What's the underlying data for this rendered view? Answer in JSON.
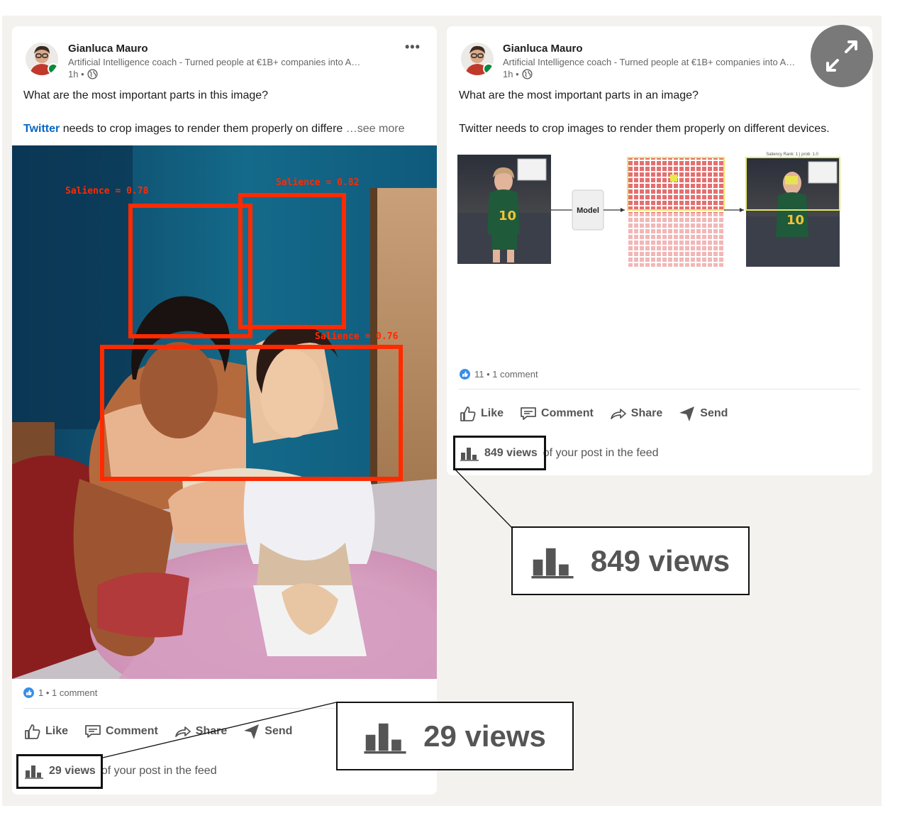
{
  "left_post": {
    "author": "Gianluca Mauro",
    "headline": "Artificial Intelligence coach - Turned people at €1B+ companies into A…",
    "time": "1h •",
    "text": "What are the most important parts in this image?",
    "line2_link": "Twitter",
    "line2_rest": " needs to crop images to render them properly on differe",
    "see_more": "…see more",
    "salience": [
      "Salience = 0.78",
      "Salience = 0.82",
      "Salience = 0.76"
    ],
    "reactions": "1 • 1 comment",
    "actions": {
      "like": "Like",
      "comment": "Comment",
      "share": "Share",
      "send": "Send"
    },
    "views": "29 views",
    "views_suffix": "of your post in the feed",
    "callout": "29 views"
  },
  "right_post": {
    "author": "Gianluca Mauro",
    "headline": "Artificial Intelligence coach - Turned people at €1B+ companies into A…",
    "time": "1h •",
    "text": "What are the most important parts in an image?",
    "line2": "Twitter needs to crop images to render them properly on different devices.",
    "diagram": {
      "model_label": "Model",
      "saliency_caption": "Saliency Rank: 1 | prob: 1.0"
    },
    "reactions": "11 • 1 comment",
    "actions": {
      "like": "Like",
      "comment": "Comment",
      "share": "Share",
      "send": "Send"
    },
    "views": "849 views",
    "views_suffix": "of your post in the feed",
    "callout": "849 views"
  },
  "colors": {
    "salience_box": "#ff2a00",
    "link": "#0a66c2",
    "canvas": "#f3f2ef",
    "online": "#0a8a3a"
  },
  "icons": [
    "more-icon",
    "globe-icon",
    "like-icon",
    "comment-icon",
    "share-icon",
    "send-icon",
    "analytics-icon",
    "expand-icon"
  ]
}
